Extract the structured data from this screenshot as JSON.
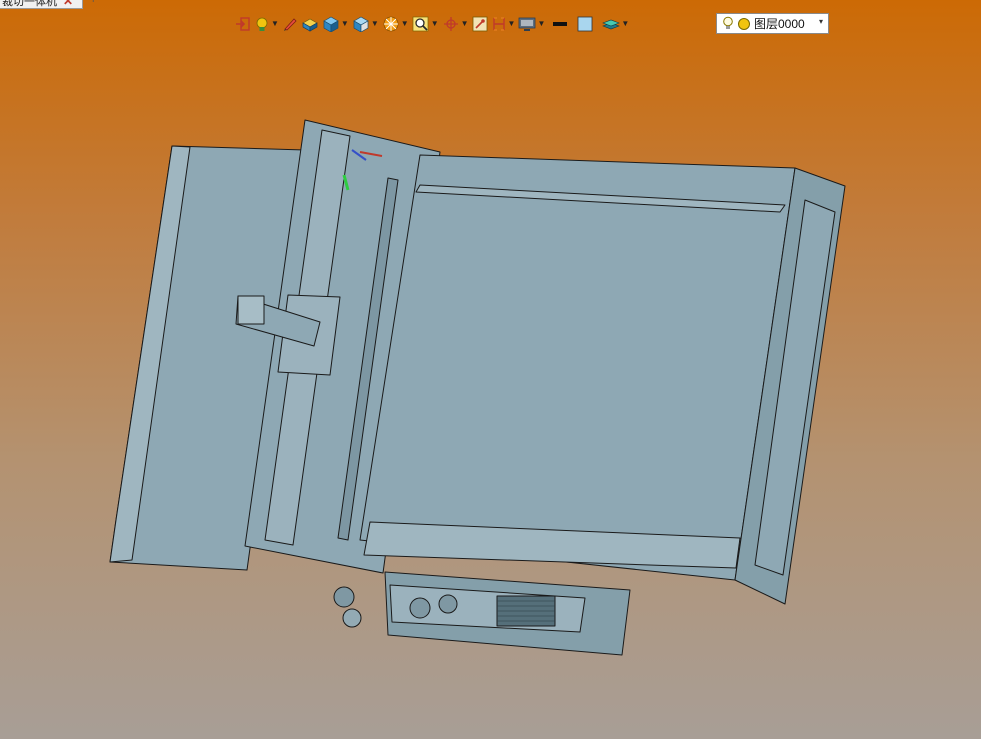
{
  "document_tab": {
    "title": "裁切一体机",
    "close": "✕",
    "add": "+"
  },
  "toolbar": {
    "items": [
      {
        "icon": "import-arrow-icon",
        "dropdown": false
      },
      {
        "icon": "light-bulb-icon",
        "dropdown": true
      },
      {
        "icon": "pen-tool-icon",
        "dropdown": false
      },
      {
        "icon": "paint-bucket-icon",
        "dropdown": false
      },
      {
        "icon": "solid-cube-icon",
        "dropdown": true
      },
      {
        "icon": "view-cube-icon",
        "dropdown": true
      },
      {
        "icon": "section-wheel-icon",
        "dropdown": true
      },
      {
        "icon": "zoom-magnifier-icon",
        "dropdown": true
      },
      {
        "icon": "crosshair-origin-icon",
        "dropdown": true
      },
      {
        "icon": "snap-point-icon",
        "dropdown": false
      },
      {
        "icon": "dimension-bracket-icon",
        "dropdown": true
      },
      {
        "icon": "display-monitor-icon",
        "dropdown": true
      },
      {
        "icon": "line-color-icon",
        "dropdown": false
      },
      {
        "icon": "fill-color-icon",
        "dropdown": false
      },
      {
        "icon": "layer-stack-icon",
        "dropdown": true
      }
    ],
    "layer_selector": {
      "value": "图层0000",
      "arrow": "▾"
    }
  },
  "viewport": {
    "background_top": "#cc6a05",
    "background_bottom": "#a89e96",
    "model_color": "#8ea8b4",
    "edge_color": "#1a1a1a"
  }
}
